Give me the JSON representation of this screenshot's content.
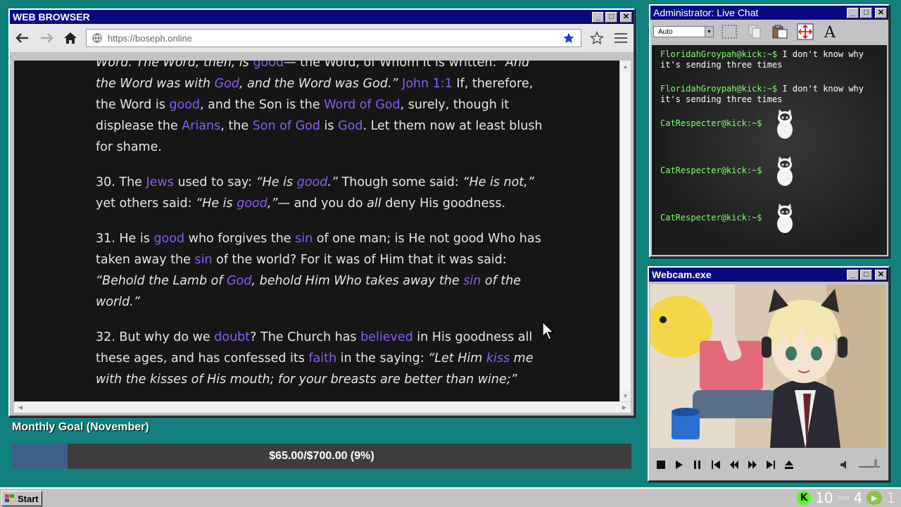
{
  "browser": {
    "title": "WEB BROWSER",
    "url": "https://boseph.online",
    "paragraphs": [
      {
        "segments": [
          {
            "t": "Word. The Word, then, is ",
            "s": "i"
          },
          {
            "t": "good",
            "s": "h"
          },
          {
            "t": "— the Word, of Whom it is written: ",
            "s": ""
          },
          {
            "t": "“And the Word was with ",
            "s": "i"
          },
          {
            "t": "God",
            "s": "hi"
          },
          {
            "t": ", and the Word was God.”",
            "s": "i"
          },
          {
            "t": " ",
            "s": ""
          },
          {
            "t": "John 1:1",
            "s": "h"
          },
          {
            "t": " If, therefore, the Word is ",
            "s": ""
          },
          {
            "t": "good",
            "s": "h"
          },
          {
            "t": ", and the Son is the ",
            "s": ""
          },
          {
            "t": "Word of God",
            "s": "h"
          },
          {
            "t": ", surely, though it displease the ",
            "s": ""
          },
          {
            "t": "Arians",
            "s": "h"
          },
          {
            "t": ", the ",
            "s": ""
          },
          {
            "t": "Son of God",
            "s": "h"
          },
          {
            "t": " is ",
            "s": ""
          },
          {
            "t": "God",
            "s": "h"
          },
          {
            "t": ". Let them now at least blush for shame.",
            "s": ""
          }
        ]
      },
      {
        "segments": [
          {
            "t": "30. The ",
            "s": ""
          },
          {
            "t": "Jews",
            "s": "h"
          },
          {
            "t": " used to say: ",
            "s": ""
          },
          {
            "t": "“He is ",
            "s": "i"
          },
          {
            "t": "good",
            "s": "hi"
          },
          {
            "t": ".”",
            "s": "i"
          },
          {
            "t": " Though some said: ",
            "s": ""
          },
          {
            "t": "“He is not,”",
            "s": "i"
          },
          {
            "t": " yet others said: ",
            "s": ""
          },
          {
            "t": "“He is ",
            "s": "i"
          },
          {
            "t": "good",
            "s": "hi"
          },
          {
            "t": ",”",
            "s": "i"
          },
          {
            "t": "— and you do ",
            "s": ""
          },
          {
            "t": "all",
            "s": "i"
          },
          {
            "t": " deny His goodness.",
            "s": ""
          }
        ]
      },
      {
        "segments": [
          {
            "t": "31. He is ",
            "s": ""
          },
          {
            "t": "good",
            "s": "h"
          },
          {
            "t": " who forgives the ",
            "s": ""
          },
          {
            "t": "sin",
            "s": "h"
          },
          {
            "t": " of one man; is He not good Who has taken away the ",
            "s": ""
          },
          {
            "t": "sin",
            "s": "h"
          },
          {
            "t": " of the world? For it was of Him that it was said: ",
            "s": ""
          },
          {
            "t": "“Behold the Lamb of ",
            "s": "i"
          },
          {
            "t": "God",
            "s": "hi"
          },
          {
            "t": ", behold Him Who takes away the ",
            "s": "i"
          },
          {
            "t": "sin",
            "s": "hi"
          },
          {
            "t": " of the world.”",
            "s": "i"
          }
        ]
      },
      {
        "segments": [
          {
            "t": "32. But why do we ",
            "s": ""
          },
          {
            "t": "doubt",
            "s": "h"
          },
          {
            "t": "? The Church has ",
            "s": ""
          },
          {
            "t": "believed",
            "s": "h"
          },
          {
            "t": " in His goodness all these ages, and has confessed its ",
            "s": ""
          },
          {
            "t": "faith",
            "s": "h"
          },
          {
            "t": " in the saying: ",
            "s": ""
          },
          {
            "t": "“Let Him ",
            "s": "i"
          },
          {
            "t": "kiss",
            "s": "hi"
          },
          {
            "t": " me with the kisses of His mouth; for your breasts are better than wine;”",
            "s": "i"
          }
        ]
      }
    ]
  },
  "goal": {
    "label": "Monthly Goal (November)",
    "text": "$65.00/$700.00 (9%)",
    "progress": 0.09
  },
  "chat": {
    "title": "Administrator: Live Chat",
    "font_select": "Auto",
    "messages": [
      {
        "user": "FloridahGroypah@kick:~$",
        "text": "I don't know why it's sending three times",
        "cat": false
      },
      {
        "user": "FloridahGroypah@kick:~$",
        "text": "I don't know why it's sending three times",
        "cat": false
      },
      {
        "user": "CatRespecter@kick:~$",
        "text": "",
        "cat": true
      },
      {
        "user": "CatRespecter@kick:~$",
        "text": "",
        "cat": true
      },
      {
        "user": "CatRespecter@kick:~$",
        "text": "",
        "cat": true
      }
    ]
  },
  "webcam": {
    "title": "Webcam.exe"
  },
  "taskbar": {
    "start": "Start",
    "kick_count": "10",
    "cozy_label": "Cozy",
    "cozy_count": "4",
    "rumble_count": "1"
  },
  "colors": {
    "desktop": "#12817d",
    "titlebar": "#0a0a80",
    "link": "#8b5cf6",
    "chat_user": "#7cff6b",
    "goal_fill": "#3e5f8a"
  }
}
